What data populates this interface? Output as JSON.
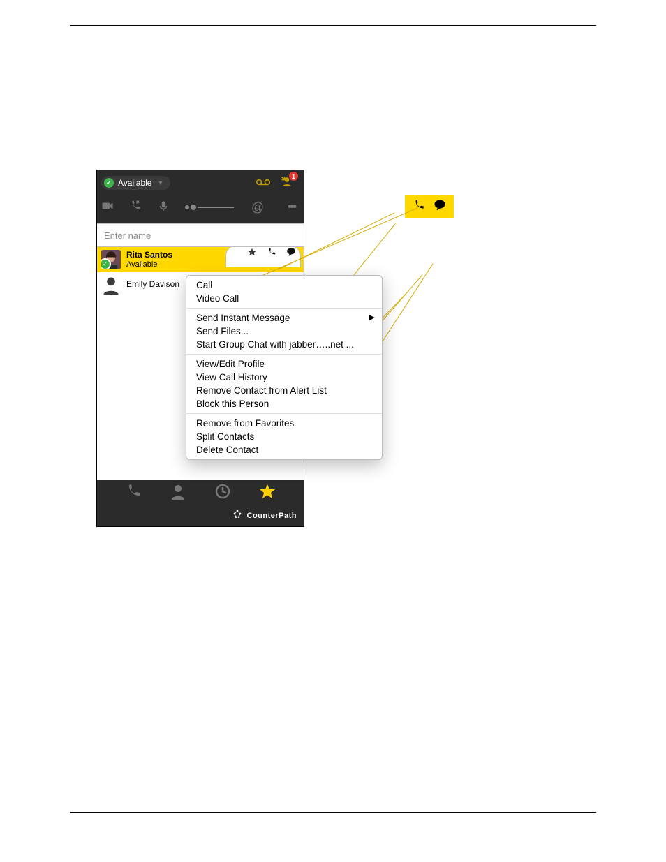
{
  "presence": {
    "label": "Available"
  },
  "missed_badge": "1",
  "search": {
    "placeholder": "Enter name"
  },
  "contacts": {
    "selected": {
      "name": "Rita Santos",
      "status": "Available"
    },
    "second": {
      "name": "Emily Davison"
    }
  },
  "menu": {
    "g1": {
      "call": "Call",
      "video": "Video Call"
    },
    "g2": {
      "im": "Send Instant Message",
      "files": "Send Files...",
      "group": "Start Group Chat with jabber…..net ..."
    },
    "g3": {
      "profile": "View/Edit Profile",
      "history": "View Call History",
      "alert": "Remove Contact from Alert List",
      "block": "Block this Person"
    },
    "g4": {
      "unfav": "Remove from Favorites",
      "split": "Split Contacts",
      "delete": "Delete Contact"
    }
  },
  "brand": "CounterPath"
}
